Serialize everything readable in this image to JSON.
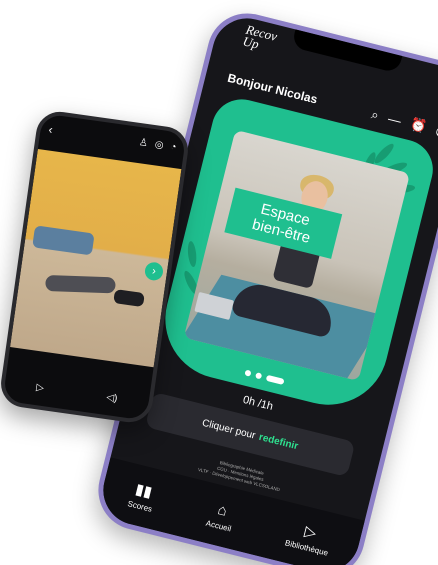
{
  "main_phone": {
    "logo": {
      "line1": "Recov",
      "line2": "Up"
    },
    "greeting": "Bonjour Nicolas",
    "top_icons": [
      "search-icon",
      "menu-icon",
      "alarm-icon",
      "notification-icon"
    ],
    "hero": {
      "title_line1": "Espace",
      "title_line2": "bien-être"
    },
    "carousel": {
      "page_count": 3,
      "active_index": 2
    },
    "timer": "0h /1h",
    "redefine": {
      "text": "Cliquer pour",
      "link": "redefinir"
    },
    "credits": [
      "Bibliographie Médicale",
      "CGU · Mentions légales",
      "VLTF · Développement web VLCSOLAND"
    ],
    "nav": [
      {
        "label": "Scores",
        "icon": "bar-chart-icon"
      },
      {
        "label": "Accueil",
        "icon": "home-icon"
      },
      {
        "label": "Bibliothèque",
        "icon": "play-icon"
      }
    ]
  },
  "small_phone": {
    "top_icons": [
      "back-icon",
      "user-icon",
      "settings-icon",
      "bell-icon"
    ],
    "controls": [
      "play-icon",
      "volume-icon"
    ]
  },
  "colors": {
    "accent": "#1fbf8f",
    "phone_frame": "#8c7fc6",
    "screen_bg": "#16161a",
    "link": "#2ee08f"
  }
}
